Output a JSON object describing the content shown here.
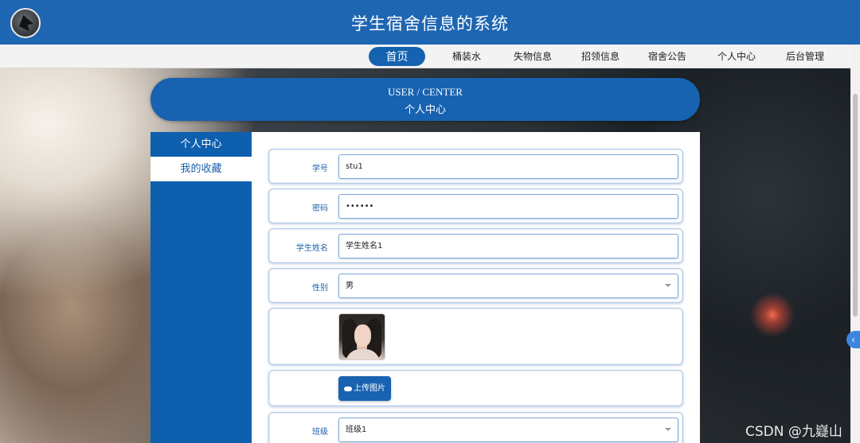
{
  "app": {
    "title": "学生宿舍信息的系统",
    "logo_icon": "bird-logo-icon"
  },
  "nav": {
    "items": [
      {
        "label": "首页",
        "active": true
      },
      {
        "label": "桶装水",
        "active": false
      },
      {
        "label": "失物信息",
        "active": false
      },
      {
        "label": "招领信息",
        "active": false
      },
      {
        "label": "宿舍公告",
        "active": false
      },
      {
        "label": "个人中心",
        "active": false
      },
      {
        "label": "后台管理",
        "active": false
      }
    ]
  },
  "banner": {
    "en": "USER / CENTER",
    "cn": "个人中心"
  },
  "sidemenu": {
    "items": [
      {
        "label": "个人中心",
        "active": true
      },
      {
        "label": "我的收藏",
        "active": false
      }
    ]
  },
  "form": {
    "student_id": {
      "label": "学号",
      "value": "stu1"
    },
    "password": {
      "label": "密码",
      "value": "••••••"
    },
    "name": {
      "label": "学生姓名",
      "value": "学生姓名1"
    },
    "gender": {
      "label": "性别",
      "value": "男"
    },
    "upload": {
      "label": "上传图片",
      "icon": "cloud-upload-icon"
    },
    "class": {
      "label": "班级",
      "value": "班级1"
    }
  },
  "watermark": "CSDN @九嶷山",
  "colors": {
    "header": "#1e66b2",
    "accent": "#1762b1",
    "label": "#1d62ad"
  }
}
